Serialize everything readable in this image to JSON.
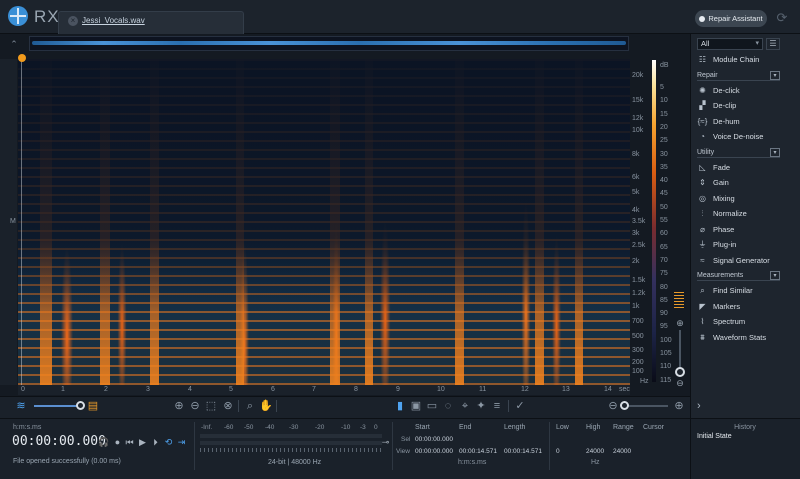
{
  "app": {
    "logo_text": "RX"
  },
  "tab": {
    "filename": "Jessi_Vocals.wav"
  },
  "header": {
    "repair_assistant_label": "Repair Assistant"
  },
  "spectrogram": {
    "time_ticks": [
      "0",
      "1",
      "2",
      "3",
      "4",
      "5",
      "6",
      "7",
      "8",
      "9",
      "10",
      "11",
      "12",
      "13",
      "14",
      "sec"
    ],
    "freq_ticks": [
      "20k",
      "15k",
      "12k",
      "10k",
      "8k",
      "6k",
      "5k",
      "4k",
      "3.5k",
      "3k",
      "2.5k",
      "2k",
      "1.5k",
      "1.2k",
      "1k",
      "700",
      "500",
      "300",
      "200",
      "100"
    ],
    "freq_unit": "Hz",
    "db_unit": "dB",
    "db_ticks": [
      "5",
      "10",
      "15",
      "20",
      "25",
      "30",
      "35",
      "40",
      "45",
      "50",
      "55",
      "60",
      "65",
      "70",
      "75",
      "80",
      "85",
      "90",
      "95",
      "100",
      "105",
      "110",
      "115"
    ],
    "channel_label": "M"
  },
  "transport": {
    "time_format": "h:m:s.ms",
    "time_display": "00:00:00.000",
    "status": "File opened successfully (0.00 ms)"
  },
  "meter": {
    "labels": [
      "-Inf.",
      "-60",
      "-50",
      "-40",
      "-30",
      "-20",
      "-10",
      "-3",
      "0"
    ],
    "format_info": "24-bit | 48000 Hz"
  },
  "selection_info": {
    "col_start": "Start",
    "col_end": "End",
    "col_length": "Length",
    "row_sel": "Sel",
    "row_view": "View",
    "sel_start": "00:00:00.000",
    "view_start": "00:00:00.000",
    "view_end": "00:00:14.571",
    "view_length": "00:00:14.571",
    "time_unit": "h:m:s.ms",
    "col_low": "Low",
    "col_high": "High",
    "col_range": "Range",
    "col_cursor": "Cursor",
    "low": "0",
    "high": "24000",
    "range": "24000",
    "freq_unit": "Hz"
  },
  "panel": {
    "filter_value": "All",
    "module_chain": "Module Chain",
    "categories": {
      "repair": "Repair",
      "utility": "Utility",
      "measurements": "Measurements"
    },
    "repair_items": [
      "De-click",
      "De-clip",
      "De-hum",
      "Voice De-noise"
    ],
    "utility_items": [
      "Fade",
      "Gain",
      "Mixing",
      "Normalize",
      "Phase",
      "Plug-in",
      "Signal Generator"
    ],
    "measurement_items": [
      "Find Similar",
      "Markers",
      "Spectrum",
      "Waveform Stats"
    ]
  },
  "history": {
    "title": "History",
    "entry": "Initial State"
  }
}
